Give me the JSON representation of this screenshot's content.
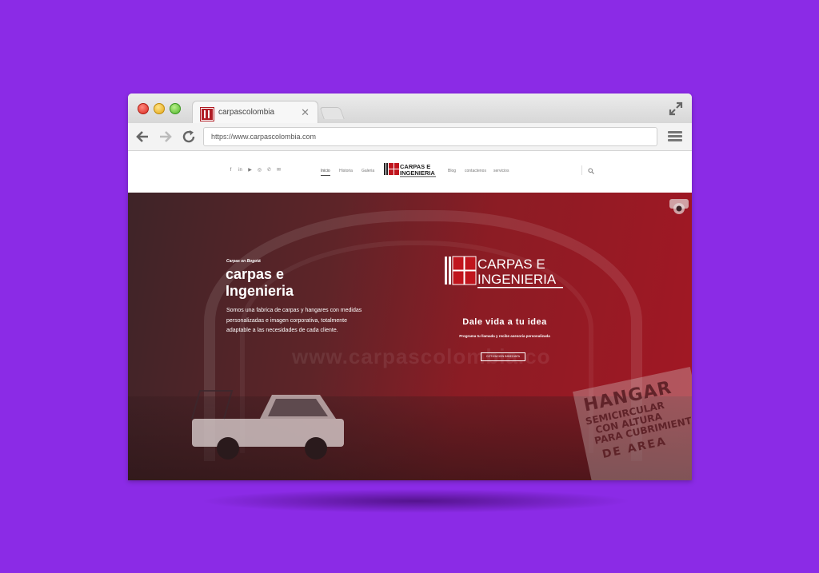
{
  "browser": {
    "tab_title": "carpascolombia",
    "url": "https://www.carpascolombia.com"
  },
  "header": {
    "social_icons": [
      "facebook-icon",
      "linkedin-icon",
      "youtube-icon",
      "instagram-icon",
      "phone-icon",
      "mail-icon"
    ],
    "nav_left": [
      "Inicio",
      "Historia",
      "Galeria"
    ],
    "nav_right": [
      "Blog",
      "contactenos",
      "servicios"
    ],
    "logo_line1": "CARPAS E",
    "logo_line2": "INGENIERIA"
  },
  "hero": {
    "subtitle": "Carpas en Bogotá",
    "title": "carpas e Ingenieria",
    "description": "Somos una fabrica de carpas y hangares con medidas personalizadas e imagen corporativa, totalmente adaptable a las necesidades de cada cliente.",
    "logo_line1": "CARPAS E",
    "logo_line2": "INGENIERIA",
    "tagline": "Dale vida a tu idea",
    "tagline_sub": "Programa tu llamada y recibe asesoria personalizada",
    "cta_label": "COTIZACION INMEDIATA",
    "watermark": "www.carpascolombia.co",
    "sign_lines": [
      "HANGAR",
      "SEMICIRCULAR",
      "CON ALTURA",
      "PARA CUBRIMIENTO",
      "DE AREA"
    ]
  },
  "colors": {
    "page_background": "#8b2be6",
    "brand_red": "#b01c24",
    "hero_overlay": "#a81c2a"
  }
}
